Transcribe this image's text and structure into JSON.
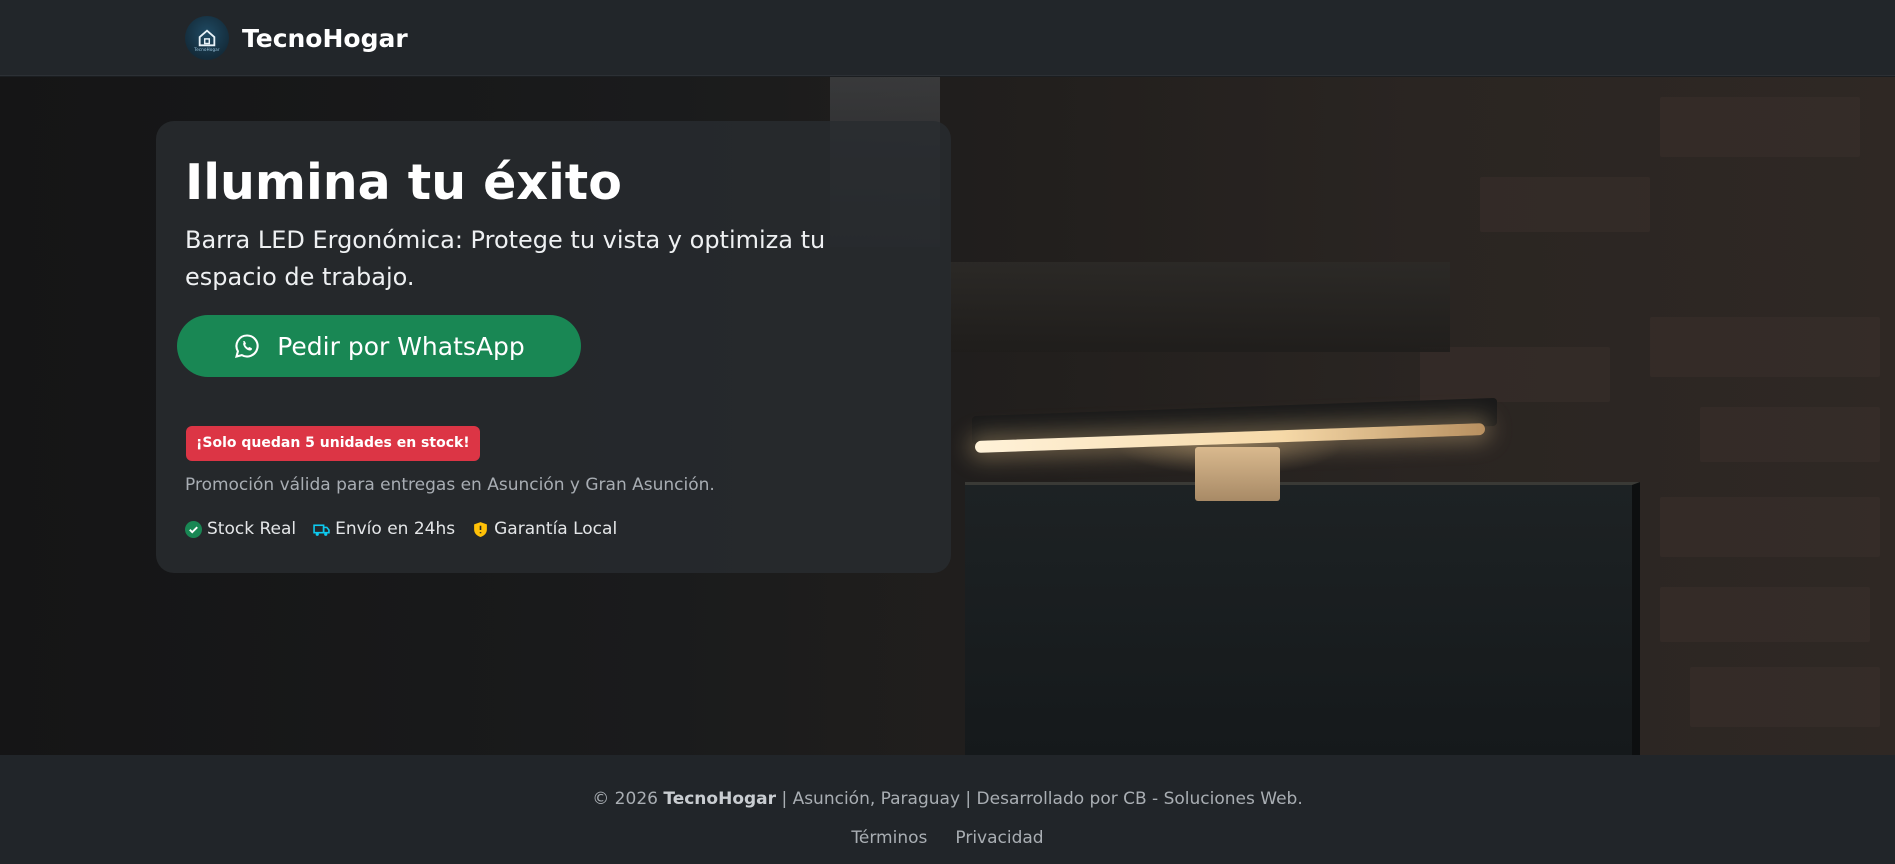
{
  "nav": {
    "brand": "TecnoHogar",
    "logo_text": "TecnoHogar",
    "logo_icon": "house-icon"
  },
  "hero": {
    "title": "Ilumina tu éxito",
    "subtitle": "Barra LED Ergonómica: Protege tu vista y optimiza tu espacio de trabajo.",
    "cta_label": "Pedir por WhatsApp",
    "cta_icon": "whatsapp-icon",
    "stock_badge": "¡Solo quedan 5 unidades en stock!",
    "promo_text": "Promoción válida para entregas en Asunción y Gran Asunción.",
    "features": [
      {
        "label": "Stock Real",
        "icon": "check-circle-icon",
        "color": "#198754"
      },
      {
        "label": "Envío en 24hs",
        "icon": "truck-icon",
        "color": "#0dcaf0"
      },
      {
        "label": "Garantía Local",
        "icon": "shield-icon",
        "color": "#ffc107"
      }
    ]
  },
  "footer": {
    "copy_prefix": "© 2026",
    "brand": "TecnoHogar",
    "copy_suffix": "| Asunción, Paraguay | Desarrollado por CB - Soluciones Web.",
    "links": [
      "Términos",
      "Privacidad"
    ]
  },
  "colors": {
    "cta": "#198754",
    "badge": "#dc3545",
    "nav_bg": "#22262a",
    "footer_bg": "#212529"
  }
}
